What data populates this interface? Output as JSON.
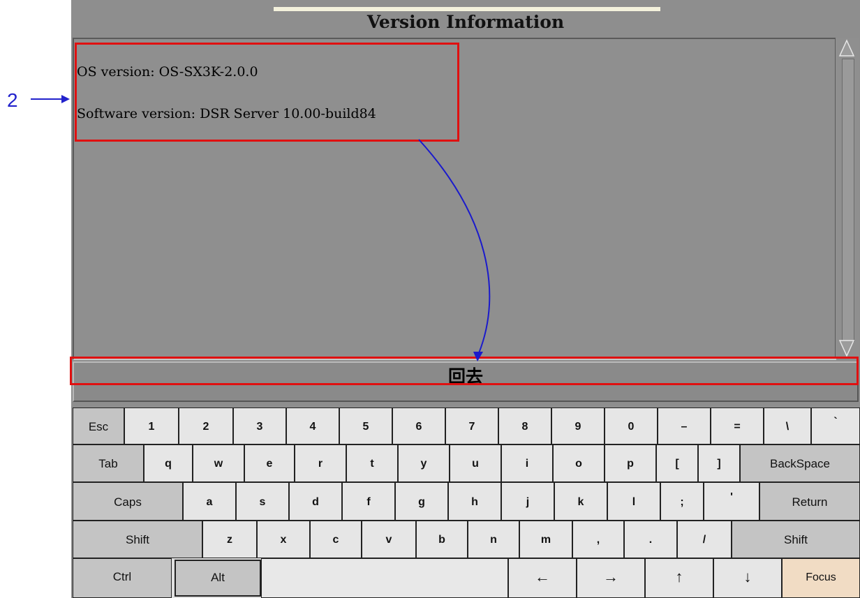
{
  "annotation": {
    "number": "2"
  },
  "window": {
    "title": "Version Information"
  },
  "info": {
    "lines": [
      "OS version: OS-SX3K-2.0.0",
      "Software version: DSR Server 10.00-build84"
    ]
  },
  "back_button": {
    "label": "回去"
  },
  "keyboard": {
    "rows": [
      [
        "Esc",
        "1",
        "2",
        "3",
        "4",
        "5",
        "6",
        "7",
        "8",
        "9",
        "0",
        "–",
        "=",
        "\\",
        "`"
      ],
      [
        "Tab",
        "q",
        "w",
        "e",
        "r",
        "t",
        "y",
        "u",
        "i",
        "o",
        "p",
        "[",
        "]",
        "BackSpace"
      ],
      [
        "Caps",
        "a",
        "s",
        "d",
        "f",
        "g",
        "h",
        "j",
        "k",
        "l",
        ";",
        "'",
        "Return"
      ],
      [
        "Shift",
        "z",
        "x",
        "c",
        "v",
        "b",
        "n",
        "m",
        ",",
        ".",
        "/",
        "Shift"
      ],
      [
        "Ctrl",
        "Alt",
        "",
        "←",
        "→",
        "↑",
        "↓",
        "Focus"
      ]
    ]
  },
  "colors": {
    "annotation": "#2222cc",
    "highlight": "#e01010",
    "focus_key": "#f1dcc4"
  }
}
